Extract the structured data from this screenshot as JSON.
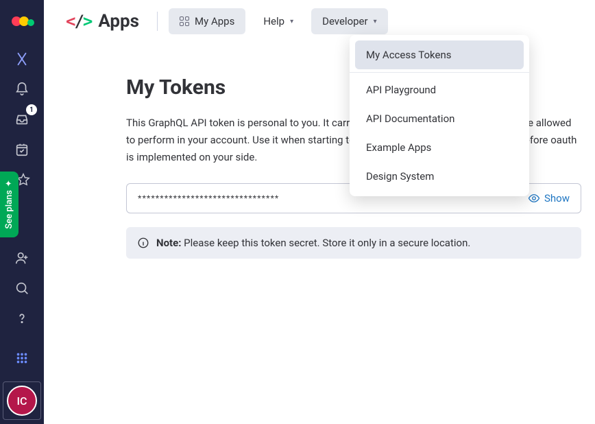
{
  "sidebar": {
    "inbox_badge": "1",
    "see_plans": "See plans",
    "avatar_initials": "IC"
  },
  "topbar": {
    "apps_label": "Apps",
    "my_apps": "My Apps",
    "help": "Help",
    "developer": "Developer"
  },
  "developer_menu": {
    "my_access_tokens": "My Access Tokens",
    "api_playground": "API Playground",
    "api_documentation": "API Documentation",
    "example_apps": "Example Apps",
    "design_system": "Design System"
  },
  "page": {
    "title": "My Tokens",
    "description": "This GraphQL API token is personal to you. It carries the permissions for any action you're allowed to perform in your account. Use it when starting to play with the API immediately even before oauth is implemented on your side.",
    "token_masked": "********************************",
    "show_label": "Show",
    "note_label": "Note:",
    "note_text": " Please keep this token secret. Store it only in a secure location."
  }
}
